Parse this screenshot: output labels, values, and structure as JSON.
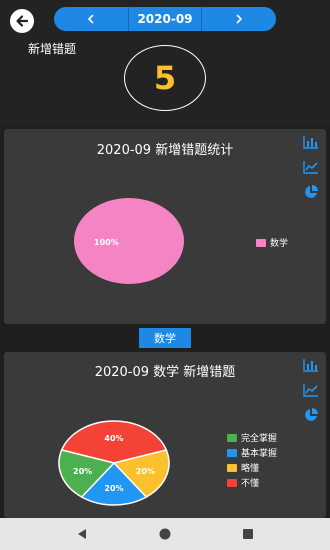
{
  "header": {
    "month": "2020-09",
    "new_label": "新增错题",
    "count": "5"
  },
  "panel1": {
    "title": "2020-09 新增错题统计",
    "chart_data": {
      "type": "pie",
      "title": "2020-09 新增错题统计",
      "slices": [
        {
          "label": "数学",
          "value": 100,
          "color": "#f484c4"
        }
      ],
      "legend_position": "right"
    },
    "data_label": "100%"
  },
  "tab": {
    "label": "数学"
  },
  "panel2": {
    "title": "2020-09 数学 新增错题",
    "chart_data": {
      "type": "pie",
      "title": "2020-09 数学 新增错题",
      "slices": [
        {
          "label": "完全掌握",
          "value": 20,
          "color": "#4caf50"
        },
        {
          "label": "基本掌握",
          "value": 20,
          "color": "#2196f3"
        },
        {
          "label": "略懂",
          "value": 20,
          "color": "#fbc02d"
        },
        {
          "label": "不懂",
          "value": 40,
          "color": "#f44336"
        }
      ],
      "legend_position": "right"
    },
    "data_labels": [
      "20%",
      "20%",
      "20%",
      "40%"
    ]
  },
  "icons": {
    "back": "back-arrow-icon",
    "prev": "chevron-left-icon",
    "next": "chevron-right-icon",
    "bar": "bar-chart-icon",
    "line": "line-chart-icon",
    "pie": "pie-chart-icon"
  }
}
